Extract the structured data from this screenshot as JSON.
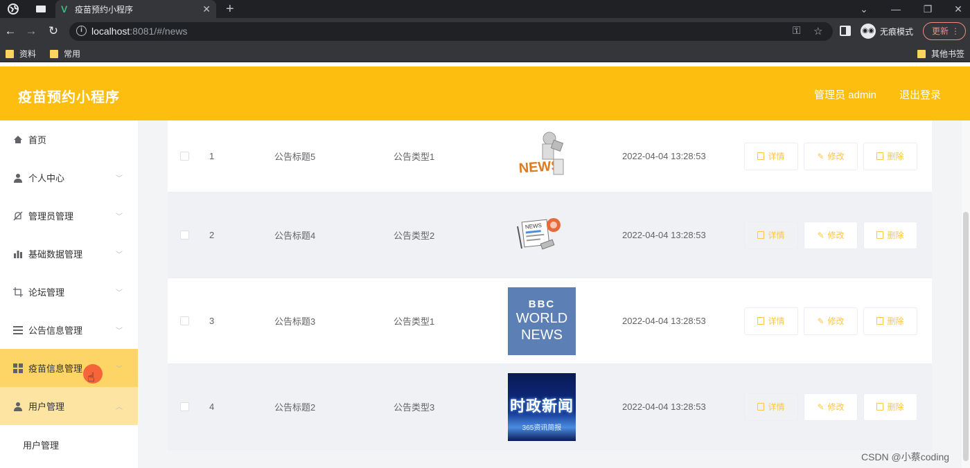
{
  "browser": {
    "tab_title": "疫苗预约小程序",
    "url_host": "localhost",
    "url_rest": ":8081/#/news",
    "incognito_label": "无痕模式",
    "update_label": "更新",
    "bookmarks": [
      "资料",
      "常用"
    ],
    "other_bookmarks": "其他书签"
  },
  "header": {
    "title": "疫苗预约小程序",
    "admin_label": "管理员 admin",
    "logout": "退出登录",
    "accent_color": "#fdbe0f"
  },
  "sidebar": {
    "items": [
      {
        "label": "首页",
        "icon": "home-icon"
      },
      {
        "label": "个人中心",
        "icon": "user-icon"
      },
      {
        "label": "管理员管理",
        "icon": "bell-off-icon"
      },
      {
        "label": "基础数据管理",
        "icon": "bar-chart-icon"
      },
      {
        "label": "论坛管理",
        "icon": "crop-icon"
      },
      {
        "label": "公告信息管理",
        "icon": "menu-icon"
      },
      {
        "label": "疫苗信息管理",
        "icon": "grid-icon"
      },
      {
        "label": "用户管理",
        "icon": "user-icon"
      }
    ],
    "submenu_item": "用户管理"
  },
  "table": {
    "rows": [
      {
        "index": "1",
        "title": "公告标题5",
        "type": "公告类型1",
        "image": "news-3d-thumbnail",
        "time": "2022-04-04 13:28:53"
      },
      {
        "index": "2",
        "title": "公告标题4",
        "type": "公告类型2",
        "image": "newspaper-thumbnail",
        "time": "2022-04-04 13:28:53"
      },
      {
        "index": "3",
        "title": "公告标题3",
        "type": "公告类型1",
        "image": "bbc-world-news-thumbnail",
        "time": "2022-04-04 13:28:53"
      },
      {
        "index": "4",
        "title": "公告标题2",
        "type": "公告类型3",
        "image": "shizheng-news-thumbnail",
        "time": "2022-04-04 13:28:53"
      }
    ],
    "actions": {
      "detail": "详情",
      "edit": "修改",
      "delete": "删除"
    }
  },
  "thumbnails": {
    "news_word": "NEWS",
    "bbc_line1": "BBC",
    "bbc_line2": "WORLD",
    "bbc_line3": "NEWS",
    "shizheng_main": "时政新闻",
    "shizheng_sub": "365资讯简报"
  },
  "watermark": "CSDN @小蔡coding"
}
